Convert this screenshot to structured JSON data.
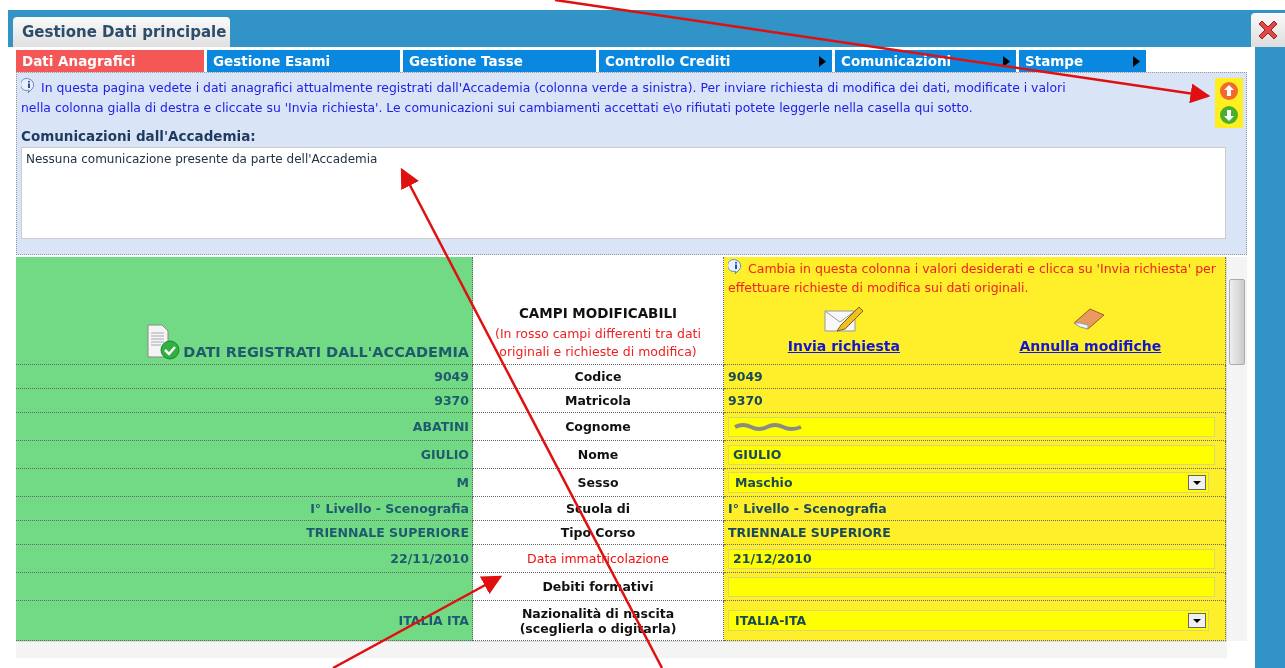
{
  "window": {
    "title": "Gestione Dati principale"
  },
  "tabs": [
    {
      "label": "Dati Anagrafici",
      "selected": true,
      "submenu": false
    },
    {
      "label": "Gestione Esami",
      "selected": false,
      "submenu": false
    },
    {
      "label": "Gestione Tasse",
      "selected": false,
      "submenu": false
    },
    {
      "label": "Controllo Crediti",
      "selected": false,
      "submenu": true
    },
    {
      "label": "Comunicazioni",
      "selected": false,
      "submenu": true
    },
    {
      "label": "Stampe",
      "selected": false,
      "submenu": true
    }
  ],
  "info": {
    "text": "In questa pagina vedete i dati anagrafici attualmente registrati dall'Accademia (colonna verde a sinistra). Per inviare richiesta di modifica dei dati, modificate i valori nella colonna gialla di destra e cliccate su 'Invia richiesta'. Le comunicazioni sui cambiamenti accettati e\\o rifiutati potete leggerle nella casella qui sotto.",
    "messages_label": "Comunicazioni dall'Accademia:",
    "messages_value": "Nessuna comunicazione presente da parte dell'Accademia"
  },
  "table": {
    "left_header": "DATI REGISTRATI DALL'ACCADEMIA",
    "middle_header": "CAMPI MODIFICABILI",
    "middle_note": "(In rosso campi differenti tra dati originali e richieste di modifica)",
    "right_note": "Cambia in questa colonna i valori desiderati e clicca su 'Invia richiesta' per effettuare richieste di modifica sui dati originali.",
    "send_link": "Invia richiesta",
    "reset_link": "Annulla modifiche",
    "rows": [
      {
        "original": "9049",
        "label": "Codice",
        "changed": false,
        "kind": "text",
        "value": "9049"
      },
      {
        "original": "9370",
        "label": "Matricola",
        "changed": false,
        "kind": "text",
        "value": "9370"
      },
      {
        "original": "ABATINI",
        "label": "Cognome",
        "changed": false,
        "kind": "input",
        "redacted": true
      },
      {
        "original": "GIULIO",
        "label": "Nome",
        "changed": false,
        "kind": "input",
        "value": "GIULIO"
      },
      {
        "original": "M",
        "label": "Sesso",
        "changed": false,
        "kind": "select",
        "value": "Maschio"
      },
      {
        "original": "I° Livello - Scenografia",
        "label": "Scuola di",
        "changed": false,
        "kind": "text",
        "value": "I° Livello - Scenografia"
      },
      {
        "original": "TRIENNALE SUPERIORE",
        "label": "Tipo Corso",
        "changed": false,
        "kind": "text",
        "value": "TRIENNALE SUPERIORE"
      },
      {
        "original": "22/11/2010",
        "label": "Data immatricolazione",
        "changed": true,
        "kind": "input",
        "value": "21/12/2010"
      },
      {
        "label": "Debiti formativi",
        "changed": false,
        "kind": "input"
      },
      {
        "original": "ITALIA ITA",
        "label": "Nazionalità di nascita",
        "label_note": "(sceglierla o digitarla)",
        "changed": false,
        "kind": "select",
        "value": "ITALIA-ITA"
      }
    ]
  }
}
